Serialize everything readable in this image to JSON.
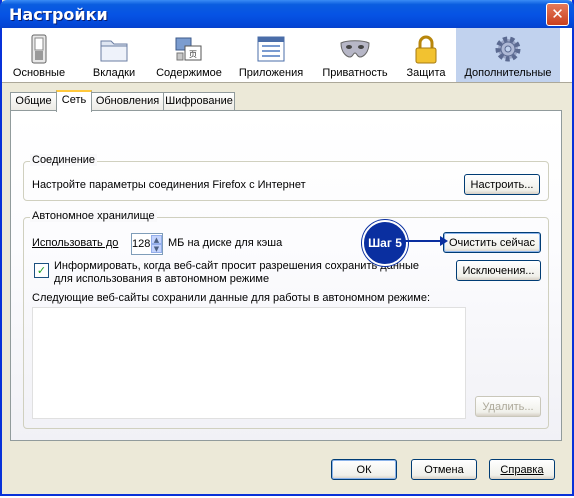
{
  "window": {
    "title": "Настройки",
    "close": "✕"
  },
  "toolbar": [
    {
      "label": "Основные",
      "icon": "switch-icon"
    },
    {
      "label": "Вкладки",
      "icon": "folder-icon"
    },
    {
      "label": "Содержимое",
      "icon": "content-icon"
    },
    {
      "label": "Приложения",
      "icon": "applications-icon"
    },
    {
      "label": "Приватность",
      "icon": "mask-icon"
    },
    {
      "label": "Защита",
      "icon": "lock-icon"
    },
    {
      "label": "Дополнительные",
      "icon": "gear-icon"
    }
  ],
  "tabs": [
    {
      "label": "Общие"
    },
    {
      "label": "Сеть"
    },
    {
      "label": "Обновления"
    },
    {
      "label": "Шифрование"
    }
  ],
  "connection": {
    "legend": "Соединение",
    "text": "Настройте параметры соединения Firefox с Интернет",
    "button": "Настроить..."
  },
  "offline": {
    "legend": "Автономное хранилище",
    "use_label": "Использовать до",
    "cache_value": "128",
    "cache_unit": "МБ на диске для кэша",
    "clear_button": "Очистить сейчас",
    "notify_line1": "Информировать, когда веб-сайт просит разрешения сохранить данные",
    "notify_line2": "для использования в автономном режиме",
    "exceptions_button": "Исключения...",
    "sites_label": "Следующие веб-сайты сохранили данные для работы в автономном режиме:",
    "delete_button": "Удалить..."
  },
  "annotation": {
    "step": "Шаг 5"
  },
  "footer": {
    "ok": "ОК",
    "cancel": "Отмена",
    "help": "Справка"
  }
}
